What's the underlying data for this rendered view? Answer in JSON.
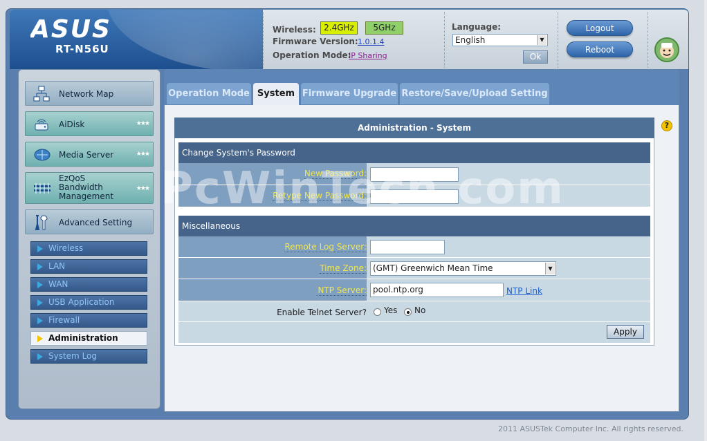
{
  "header": {
    "brand": "ASUS",
    "model": "RT-N56U",
    "wireless_label": "Wireless:",
    "band_24": "2.4GHz",
    "band_5": "5GHz",
    "firmware_label": "Firmware Version:",
    "firmware_value": "1.0.1.4",
    "opmode_label": "Operation Mode:",
    "opmode_value": "IP Sharing",
    "language_label": "Language:",
    "language_value": "English",
    "ok_label": "Ok",
    "logout_label": "Logout",
    "reboot_label": "Reboot"
  },
  "sidebar": {
    "items": [
      {
        "label": "Network Map",
        "icon": "network-map-icon"
      },
      {
        "label": "AiDisk",
        "icon": "disk-icon"
      },
      {
        "label": "Media Server",
        "icon": "media-server-icon"
      },
      {
        "label_lines": [
          "EzQoS",
          "Bandwidth",
          "Management"
        ],
        "icon": "qos-icon"
      },
      {
        "label": "Advanced Setting",
        "icon": "wrench-icon"
      }
    ],
    "sub_items": [
      {
        "label": "Wireless",
        "active": false
      },
      {
        "label": "LAN",
        "active": false
      },
      {
        "label": "WAN",
        "active": false
      },
      {
        "label": "USB Application",
        "active": false
      },
      {
        "label": "Firewall",
        "active": false
      },
      {
        "label": "Administration",
        "active": true
      },
      {
        "label": "System Log",
        "active": false
      }
    ]
  },
  "tabs": [
    {
      "label": "Operation Mode",
      "active": false
    },
    {
      "label": "System",
      "active": true
    },
    {
      "label": "Firmware Upgrade",
      "active": false
    },
    {
      "label": "Restore/Save/Upload Setting",
      "active": false
    }
  ],
  "panel": {
    "title": "Administration - System",
    "password_section": {
      "heading": "Change System's Password",
      "new_password_label": "New Password:",
      "new_password_value": "",
      "retype_label": "Retype New Password:",
      "retype_value": ""
    },
    "misc_section": {
      "heading": "Miscellaneous",
      "remote_log_label": "Remote Log Server:",
      "remote_log_value": "",
      "timezone_label": "Time Zone:",
      "timezone_value": "(GMT) Greenwich Mean Time",
      "ntp_label": "NTP Server:",
      "ntp_value": "pool.ntp.org",
      "ntp_link": "NTP Link",
      "telnet_label": "Enable Telnet Server?",
      "telnet_yes": "Yes",
      "telnet_no": "No",
      "telnet_selected": "No"
    },
    "apply_label": "Apply"
  },
  "watermark": "PcWinTech.com",
  "footer": "2011 ASUSTek Computer Inc. All rights reserved.",
  "colors": {
    "frame_blue": "#5a7fae",
    "sidebar_sub": "#34598a",
    "label_yellow": "#f0e650",
    "band_24": "#d8f000",
    "band_5": "#8fd06a"
  }
}
